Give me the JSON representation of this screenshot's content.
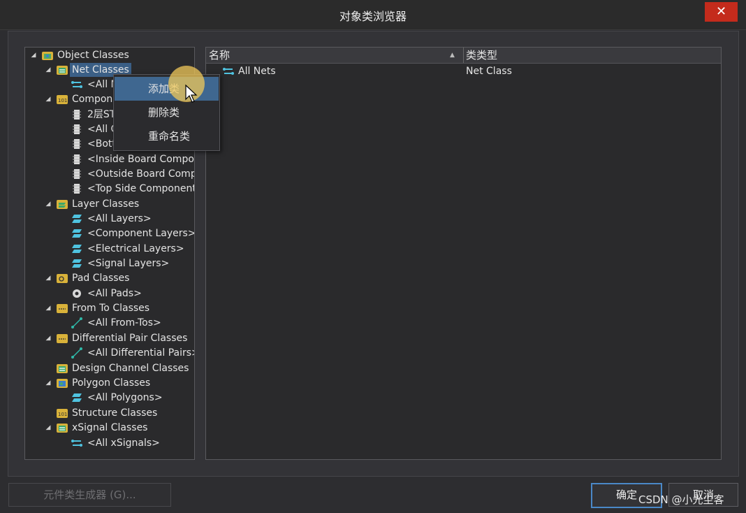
{
  "window": {
    "title": "对象类浏览器",
    "close_label": "✕"
  },
  "tree": {
    "root": "Object Classes",
    "net_classes": "Net Classes",
    "all_nets": "<All Nets>",
    "component_classes": "Component Classes",
    "comp_2layer": "2层STM32",
    "all_components": "<All Components>",
    "bottom_side": "<Bottom Side Components>",
    "inside_board": "<Inside Board Components>",
    "outside_board": "<Outside Board Components>",
    "top_side": "<Top Side Components>",
    "layer_classes": "Layer Classes",
    "all_layers": "<All Layers>",
    "component_layers": "<Component Layers>",
    "electrical_layers": "<Electrical Layers>",
    "signal_layers": "<Signal Layers>",
    "pad_classes": "Pad Classes",
    "all_pads": "<All Pads>",
    "from_to_classes": "From To Classes",
    "all_from_tos": "<All From-Tos>",
    "diff_pair_classes": "Differential Pair Classes",
    "all_diff_pairs": "<All Differential Pairs>",
    "design_channel_classes": "Design Channel Classes",
    "polygon_classes": "Polygon Classes",
    "all_polygons": "<All Polygons>",
    "structure_classes": "Structure Classes",
    "xsignal_classes": "xSignal Classes",
    "all_xsignals": "<All xSignals>"
  },
  "list": {
    "col_name": "名称",
    "col_type": "类类型",
    "rows": [
      {
        "name": "All Nets",
        "type": "Net Class"
      }
    ]
  },
  "context_menu": {
    "add": "添加类",
    "delete": "删除类",
    "rename": "重命名类"
  },
  "buttons": {
    "generator": "元件类生成器 (G)...",
    "ok": "确定",
    "cancel": "取消"
  },
  "watermark": "CSDN @小光尘客",
  "colors": {
    "accent": "#3b5f86",
    "close": "#c42b1c",
    "primary_border": "#4a88c7"
  }
}
